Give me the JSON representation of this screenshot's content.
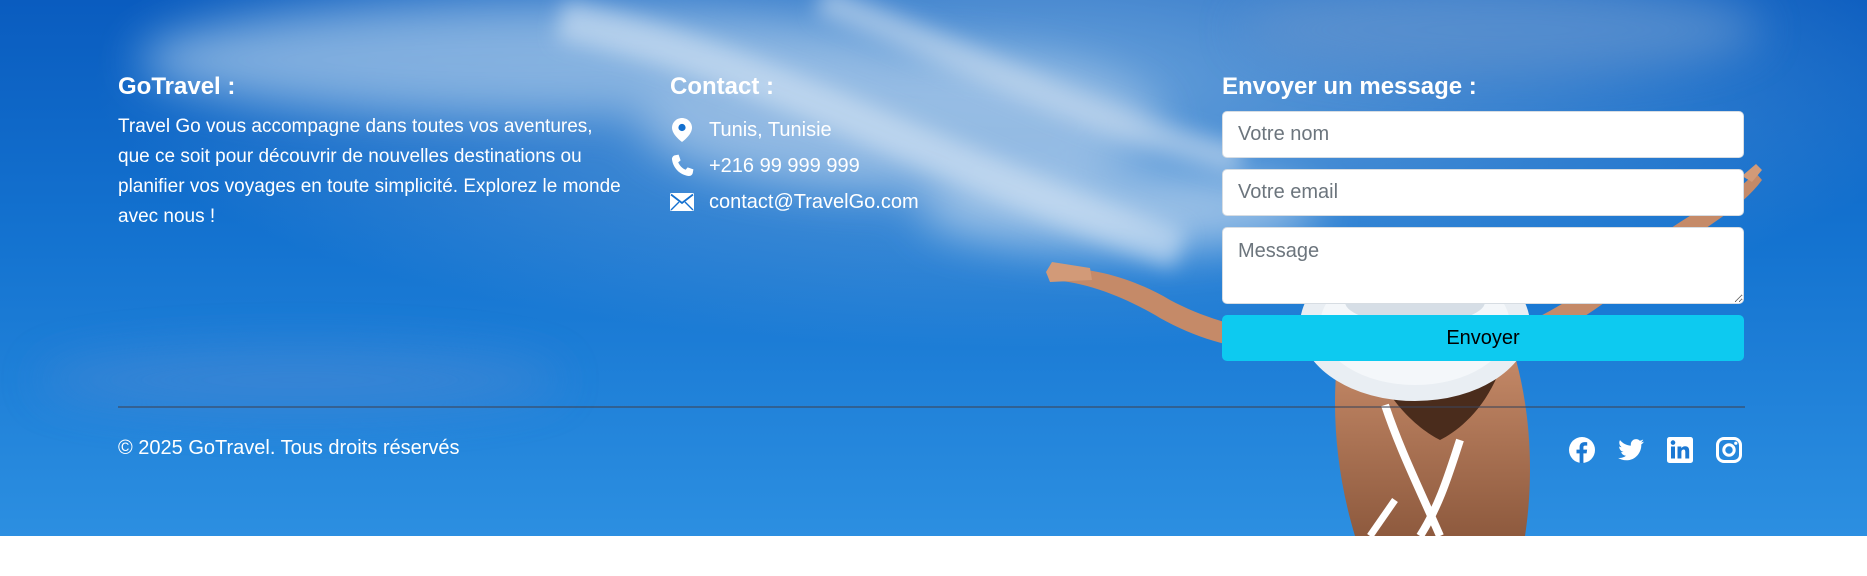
{
  "about": {
    "title": "GoTravel :",
    "text": "Travel Go vous accompagne dans toutes vos aventures, que ce soit pour découvrir de nouvelles destinations ou planifier vos voyages en toute simplicité. Explorez le monde avec nous !"
  },
  "contact": {
    "title": "Contact :",
    "items": [
      {
        "icon": "map-pin-icon",
        "text": "Tunis, Tunisie"
      },
      {
        "icon": "phone-icon",
        "text": "+216 99 999 999"
      },
      {
        "icon": "envelope-icon",
        "text": "contact@TravelGo.com"
      }
    ]
  },
  "form": {
    "title": "Envoyer un message :",
    "name_placeholder": "Votre nom",
    "email_placeholder": "Votre email",
    "message_placeholder": "Message",
    "submit_label": "Envoyer"
  },
  "footer": {
    "copyright": "© 2025 GoTravel. Tous droits réservés",
    "socials": [
      "facebook-icon",
      "twitter-icon",
      "linkedin-icon",
      "instagram-icon"
    ]
  },
  "colors": {
    "accent": "#0dcaf0",
    "text": "#ffffff",
    "sky": "#1170cf"
  }
}
